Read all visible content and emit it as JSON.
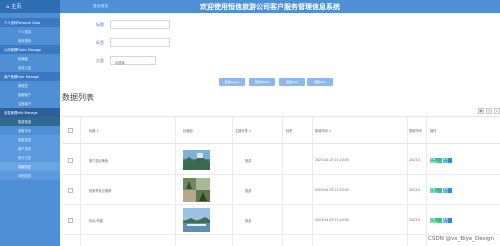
{
  "app": {
    "home_label": "主页",
    "breadcrumb": "首页/首页",
    "title": "欢迎使用恒信旅游公司客户服务管理信息系统"
  },
  "sidebar": {
    "groups": [
      {
        "label": "个人资料Personal Data",
        "items": [
          "个人信息",
          "修改密码"
        ]
      },
      {
        "label": "公司管理Public Manage",
        "items": [
          "轮播图",
          "系统公告"
        ]
      },
      {
        "label": "用户管理User Manage",
        "items": [
          "管理员",
          "客服客户",
          "注册客户"
        ]
      },
      {
        "label": "信息管理Info Manage",
        "items": [
          "旅游信息",
          "游客评论",
          "客服信息",
          "客户反馈",
          "旅行日志",
          "客服回复",
          "其他回复"
        ]
      }
    ]
  },
  "filters": {
    "title_label": "标题",
    "tag_label": "标签",
    "category_label": "分类",
    "category_value": "请选择"
  },
  "buttons": {
    "query": "查询Query",
    "reset": "重置Reset",
    "add": "添加Add",
    "delete": "删除Del"
  },
  "list_title": "数据列表",
  "table": {
    "headers": [
      "标题",
      "封面图",
      "主题分类",
      "标签",
      "新增时间",
      "更新时间",
      "操作"
    ],
    "rows": [
      {
        "title": "厦门游记美食",
        "category": "旅游",
        "created": "2023-04-03 21:20:05",
        "updated": "2023-0"
      },
      {
        "title": "张家界景点推荐",
        "category": "旅游",
        "created": "2023-04-03 21:20:05",
        "updated": "2023-0"
      },
      {
        "title": "杭州/乌镇",
        "category": "旅游",
        "created": "2023-04-03 21:20:05",
        "updated": "2023-0"
      }
    ],
    "detail_label": "详情Detail",
    "edit_label": "编辑Edit"
  },
  "watermark": "CSDN @vx_Biye_Design",
  "colors": {
    "sidebar": "#4e8fd6",
    "topbar": "#4e8fd6",
    "button": "#8fb8ea",
    "detail": "#3fbf8b",
    "edit": "#2b8fd6"
  }
}
